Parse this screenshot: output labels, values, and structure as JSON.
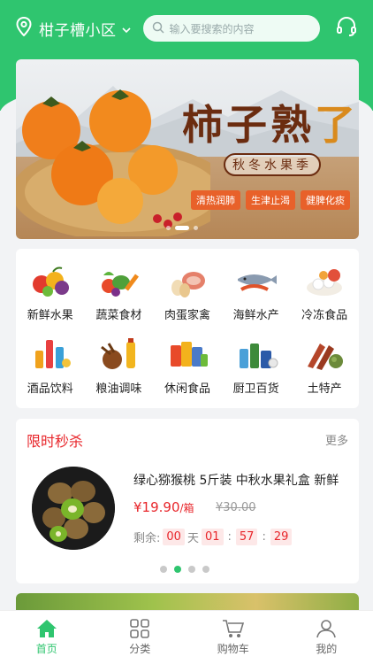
{
  "header": {
    "location": "柑子槽小区",
    "search_placeholder": "输入要搜索的内容"
  },
  "banner": {
    "title_part1": "柿子熟",
    "title_part2": "了",
    "subtitle": "秋冬水果季",
    "tags": [
      "清热润肺",
      "生津止渴",
      "健脾化痰"
    ]
  },
  "categories": [
    {
      "label": "新鲜水果",
      "icon": "fruit-icon"
    },
    {
      "label": "蔬菜食材",
      "icon": "vegetable-icon"
    },
    {
      "label": "肉蛋家禽",
      "icon": "meat-icon"
    },
    {
      "label": "海鲜水产",
      "icon": "seafood-icon"
    },
    {
      "label": "冷冻食品",
      "icon": "frozen-food-icon"
    },
    {
      "label": "酒品饮料",
      "icon": "drinks-icon"
    },
    {
      "label": "粮油调味",
      "icon": "grain-oil-icon"
    },
    {
      "label": "休闲食品",
      "icon": "snacks-icon"
    },
    {
      "label": "厨卫百货",
      "icon": "kitchen-goods-icon"
    },
    {
      "label": "土特产",
      "icon": "local-specialty-icon"
    }
  ],
  "flash_sale": {
    "title": "限时秒杀",
    "more": "更多",
    "product_name": "绿心猕猴桃 5斤装 中秋水果礼盒 新鲜",
    "price": "¥19.90",
    "price_unit": "/箱",
    "old_price": "¥30.00",
    "countdown_label": "剩余:",
    "days": "00",
    "days_unit": "天",
    "hours": "01",
    "minutes": "57",
    "seconds": "29"
  },
  "tabbar": [
    {
      "label": "首页",
      "active": true
    },
    {
      "label": "分类",
      "active": false
    },
    {
      "label": "购物车",
      "active": false
    },
    {
      "label": "我的",
      "active": false
    }
  ],
  "colors": {
    "brand_green": "#2fc56f",
    "sale_red": "#e8262b"
  }
}
